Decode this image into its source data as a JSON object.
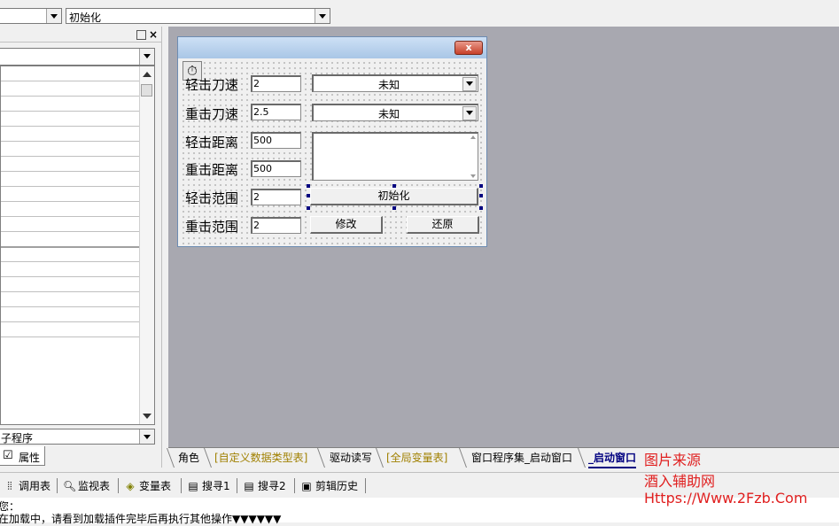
{
  "top": {
    "combo_value": "初始化"
  },
  "left_panel": {
    "selector_label": "子程序",
    "tab_label": "属性",
    "ellipsis": "..."
  },
  "form": {
    "close_glyph": "x",
    "rows": [
      {
        "label": "轻击刀速",
        "value": "2"
      },
      {
        "label": "重击刀速",
        "value": "2.5"
      },
      {
        "label": "轻击距离",
        "value": "500"
      },
      {
        "label": "重击距离",
        "value": "500"
      },
      {
        "label": "轻击范围",
        "value": "2"
      },
      {
        "label": "重击范围",
        "value": "2"
      }
    ],
    "dropdown1_value": "未知",
    "dropdown2_value": "未知",
    "init_button": "初始化",
    "modify_button": "修改",
    "restore_button": "还原"
  },
  "tabs": [
    {
      "label": "角色"
    },
    {
      "label": "[自定义数据类型表]"
    },
    {
      "label": "驱动读写"
    },
    {
      "label": "[全局变量表]"
    },
    {
      "label": "窗口程序集_启动窗口"
    },
    {
      "label": "_启动窗口"
    }
  ],
  "bottom_tools": [
    {
      "label": "调用表",
      "icon": "call-table-icon"
    },
    {
      "label": "监视表",
      "icon": "magnifier-icon"
    },
    {
      "label": "变量表",
      "icon": "variable-icon"
    },
    {
      "label": "搜寻1",
      "icon": "search-list-icon"
    },
    {
      "label": "搜寻2",
      "icon": "search-list-icon"
    },
    {
      "label": "剪辑历史",
      "icon": "clipboard-icon"
    }
  ],
  "output": {
    "line1": "您：",
    "line2": "在加载中，请看到加载插件完毕后再执行其他操作▼▼▼▼▼▼"
  },
  "watermark": {
    "line1": "图片来源",
    "line2": "酒入辅助网",
    "line3": "Https://Www.2Fzb.Com"
  }
}
